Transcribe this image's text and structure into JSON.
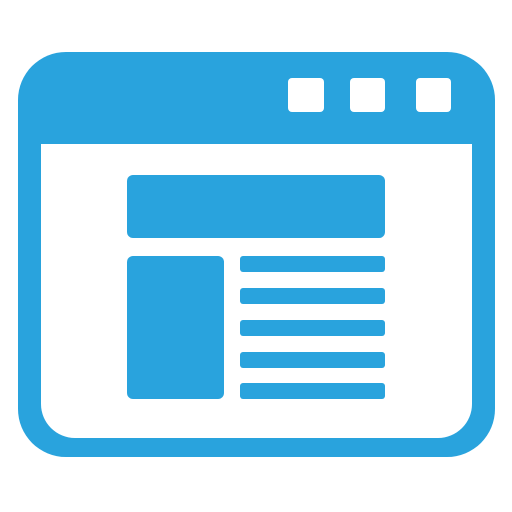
{
  "icon": {
    "name": "browser-window-article-layout-icon",
    "colors": {
      "primary": "#29a3dd",
      "background": "#ffffff",
      "window_body": "#ffffff"
    },
    "window_controls": [
      {
        "name": "window-control-1"
      },
      {
        "name": "window-control-2"
      },
      {
        "name": "window-control-3"
      }
    ],
    "content": {
      "header_block": true,
      "image_block": true,
      "text_lines": 5
    }
  }
}
